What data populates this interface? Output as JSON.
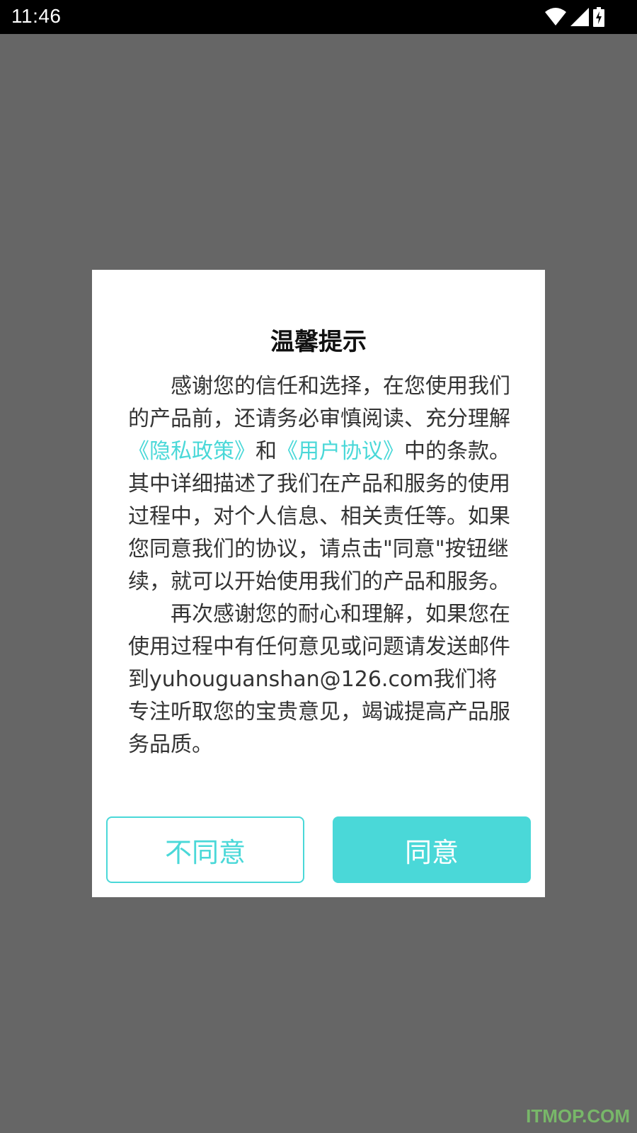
{
  "status_bar": {
    "time": "11:46",
    "icons": [
      "wifi-icon",
      "cell-signal-icon",
      "battery-charging-icon"
    ]
  },
  "dialog": {
    "title": "温馨提示",
    "para1_part1": "感谢您的信任和选择，在您使用我们的产品前，还请务必审慎阅读、充分理解",
    "privacy_link": "《隐私政策》",
    "para1_and": "和",
    "user_agreement_link": "《用户协议》",
    "para1_part2": "中的条款。其中详细描述了我们在产品和服务的使用过程中，对个人信息、相关责任等。如果您同意我们的协议，请点击\"同意\"按钮继续，就可以开始使用我们的产品和服务。",
    "para2": "再次感谢您的耐心和理解，如果您在使用过程中有任何意见或问题请发送邮件到yuhouguanshan@126.com我们将专注听取您的宝贵意见，竭诚提高产品服务品质。",
    "disagree_label": "不同意",
    "agree_label": "同意"
  },
  "colors": {
    "accent": "#4ad8d8",
    "overlay": "#666666",
    "status_bar": "#000000"
  },
  "watermark": "ITMOP.COM"
}
